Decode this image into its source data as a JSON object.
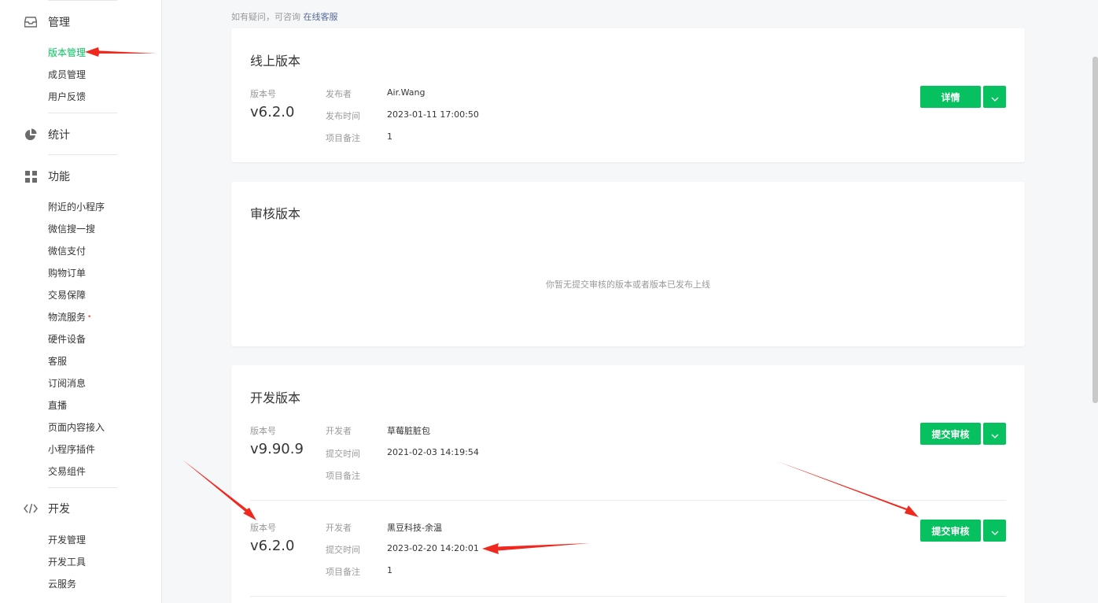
{
  "sidebar": {
    "manage": {
      "title": "管理",
      "items": [
        {
          "label": "版本管理",
          "active": true
        },
        {
          "label": "成员管理"
        },
        {
          "label": "用户反馈"
        }
      ]
    },
    "stats": {
      "title": "统计"
    },
    "features": {
      "title": "功能",
      "items": [
        {
          "label": "附近的小程序"
        },
        {
          "label": "微信搜一搜"
        },
        {
          "label": "微信支付"
        },
        {
          "label": "购物订单"
        },
        {
          "label": "交易保障"
        },
        {
          "label": "物流服务",
          "badge": "•"
        },
        {
          "label": "硬件设备"
        },
        {
          "label": "客服"
        },
        {
          "label": "订阅消息"
        },
        {
          "label": "直播"
        },
        {
          "label": "页面内容接入"
        },
        {
          "label": "小程序插件"
        },
        {
          "label": "交易组件"
        }
      ]
    },
    "develop": {
      "title": "开发",
      "items": [
        {
          "label": "开发管理"
        },
        {
          "label": "开发工具"
        },
        {
          "label": "云服务"
        }
      ]
    }
  },
  "hint": {
    "text": "如有疑问，可咨询",
    "link": "在线客服"
  },
  "online": {
    "title": "线上版本",
    "version_label": "版本号",
    "version": "v6.2.0",
    "fields": [
      {
        "label": "发布者",
        "value": "Air.Wang"
      },
      {
        "label": "发布时间",
        "value": "2023-01-11 17:00:50"
      },
      {
        "label": "项目备注",
        "value": "1"
      }
    ],
    "button": "详情"
  },
  "review": {
    "title": "审核版本",
    "empty_text": "你暂无提交审核的版本或者版本已发布上线"
  },
  "dev": {
    "title": "开发版本",
    "rows": [
      {
        "version_label": "版本号",
        "version": "v9.90.9",
        "fields": [
          {
            "label": "开发者",
            "value": "草莓脏脏包"
          },
          {
            "label": "提交时间",
            "value": "2021-02-03 14:19:54"
          },
          {
            "label": "项目备注",
            "value": ""
          }
        ],
        "button": "提交审核"
      },
      {
        "version_label": "版本号",
        "version": "v6.2.0",
        "fields": [
          {
            "label": "开发者",
            "value": "黑豆科技-余温"
          },
          {
            "label": "提交时间",
            "value": "2023-02-20 14:20:01"
          },
          {
            "label": "项目备注",
            "value": "1"
          }
        ],
        "button": "提交审核"
      }
    ]
  },
  "colors": {
    "accent": "#07c160",
    "annotation": "#f0281e",
    "link": "#576b95"
  },
  "icons": [
    "inbox-icon",
    "pie-chart-icon",
    "grid-icon",
    "code-icon",
    "chevron-down-icon"
  ]
}
